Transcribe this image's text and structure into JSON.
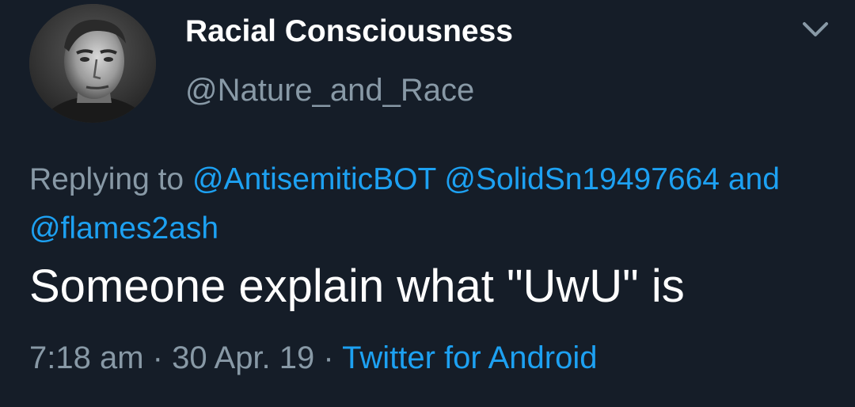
{
  "author": {
    "display_name": "Racial Consciousness",
    "handle": "@Nature_and_Race",
    "avatar_icon": "portrait-photo"
  },
  "reply": {
    "prefix": "Replying to",
    "mentions": [
      "@AntisemiticBOT",
      "@SolidSn19497664",
      "@flames2ash"
    ],
    "conjunction": "and"
  },
  "tweet": {
    "text": "Someone explain what \"UwU\" is"
  },
  "meta": {
    "time": "7:18 am",
    "date": "30 Apr. 19",
    "separator": "·",
    "source": "Twitter for Android"
  },
  "menu": {
    "icon": "chevron-down-icon"
  },
  "colors": {
    "background": "#151d28",
    "primary_text": "#ffffff",
    "secondary_text": "#8899a6",
    "link": "#1da1f2"
  }
}
